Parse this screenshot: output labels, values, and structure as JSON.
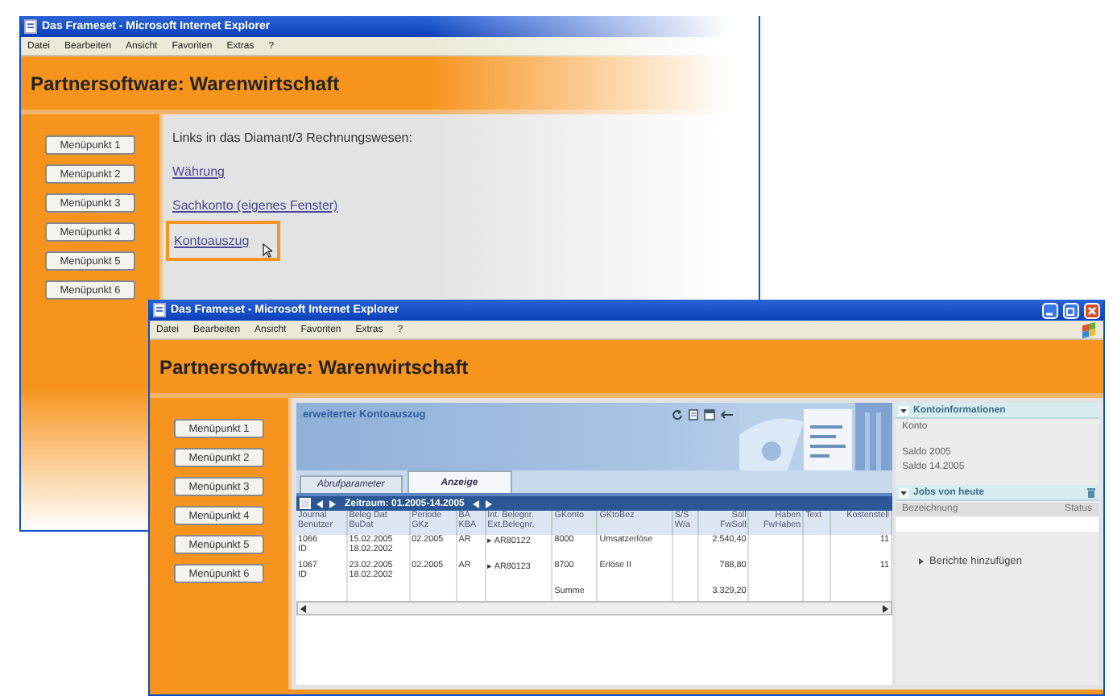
{
  "windows": [
    {
      "kind": "links",
      "title": "Das Frameset - Microsoft Internet Explorer",
      "window_buttons": false,
      "faded": true,
      "menu": [
        "Datei",
        "Bearbeiten",
        "Ansicht",
        "Favoriten",
        "Extras",
        "?"
      ],
      "header": "Partnersoftware: Warenwirtschaft",
      "menu_buttons": [
        "Menüpunkt 1",
        "Menüpunkt 2",
        "Menüpunkt 3",
        "Menüpunkt 4",
        "Menüpunkt 5",
        "Menüpunkt 6"
      ],
      "content": {
        "heading": "Links in das Diamant/3 Rechnungswesen:",
        "links": [
          {
            "label": "Währung",
            "highlighted": false
          },
          {
            "label": "Sachkonto (eigenes Fenster)",
            "highlighted": false
          },
          {
            "label": "Kontoauszug",
            "highlighted": true
          }
        ]
      }
    },
    {
      "kind": "statement",
      "title": "Das Frameset - Microsoft Internet Explorer",
      "window_buttons": true,
      "faded": false,
      "menu": [
        "Datei",
        "Bearbeiten",
        "Ansicht",
        "Favoriten",
        "Extras",
        "?"
      ],
      "header": "Partnersoftware: Warenwirtschaft",
      "menu_buttons": [
        "Menüpunkt 1",
        "Menüpunkt 2",
        "Menüpunkt 3",
        "Menüpunkt 4",
        "Menüpunkt 5",
        "Menüpunkt 6"
      ],
      "content": {
        "panel_title": "erweiterter Kontoauszug",
        "tabs": [
          {
            "label": "Abrufparameter",
            "selected": false
          },
          {
            "label": "Anzeige",
            "selected": true
          }
        ],
        "period": "Zeitraum: 01.2005-14.2005",
        "table": {
          "columns": [
            {
              "label": "Journal\nBenutzer",
              "numeric": false
            },
            {
              "label": "Beleg Dat\nBuDat",
              "numeric": false
            },
            {
              "label": "Periode\nGKz",
              "numeric": false
            },
            {
              "label": "BA\nKBA",
              "numeric": false
            },
            {
              "label": "Int. Belegnr.\nExt.Belegnr.",
              "numeric": false
            },
            {
              "label": "GKonto",
              "numeric": false
            },
            {
              "label": "GKtoBez",
              "numeric": false
            },
            {
              "label": "S/S\nW/a",
              "numeric": false
            },
            {
              "label": "Soll\nFwSoll",
              "numeric": true
            },
            {
              "label": "Haben\nFwHaben",
              "numeric": true
            },
            {
              "label": "Text",
              "numeric": false
            },
            {
              "label": "Kostenstell",
              "numeric": true
            }
          ],
          "rows": [
            {
              "cells": [
                "1066\nID",
                "15.02.2005\n18.02.2002",
                "02.2005",
                "AR",
                "▸ AR80122",
                "8000",
                "Umsatzerlöse",
                "",
                "2.540,40",
                "",
                "",
                "11"
              ]
            },
            {
              "cells": [
                "1067\nID",
                "23.02.2005\n18.02.2002",
                "02.2005",
                "AR",
                "▸ AR80123",
                "8700",
                "Erlöse II",
                "",
                "788,80",
                "",
                "",
                "11"
              ]
            },
            {
              "cells": [
                "",
                "",
                "",
                "",
                "",
                "Summe",
                "",
                "",
                "3.329,20",
                "",
                "",
                ""
              ]
            }
          ]
        },
        "info": {
          "title": "Kontoinformationen",
          "rows": [
            "Konto",
            "Saldo 2005",
            "Saldo 14.2005"
          ]
        },
        "jobs": {
          "title": "Jobs von heute",
          "columns": [
            "Bezeichnung",
            "Status"
          ],
          "action": "Berichte hinzufügen"
        }
      }
    }
  ]
}
